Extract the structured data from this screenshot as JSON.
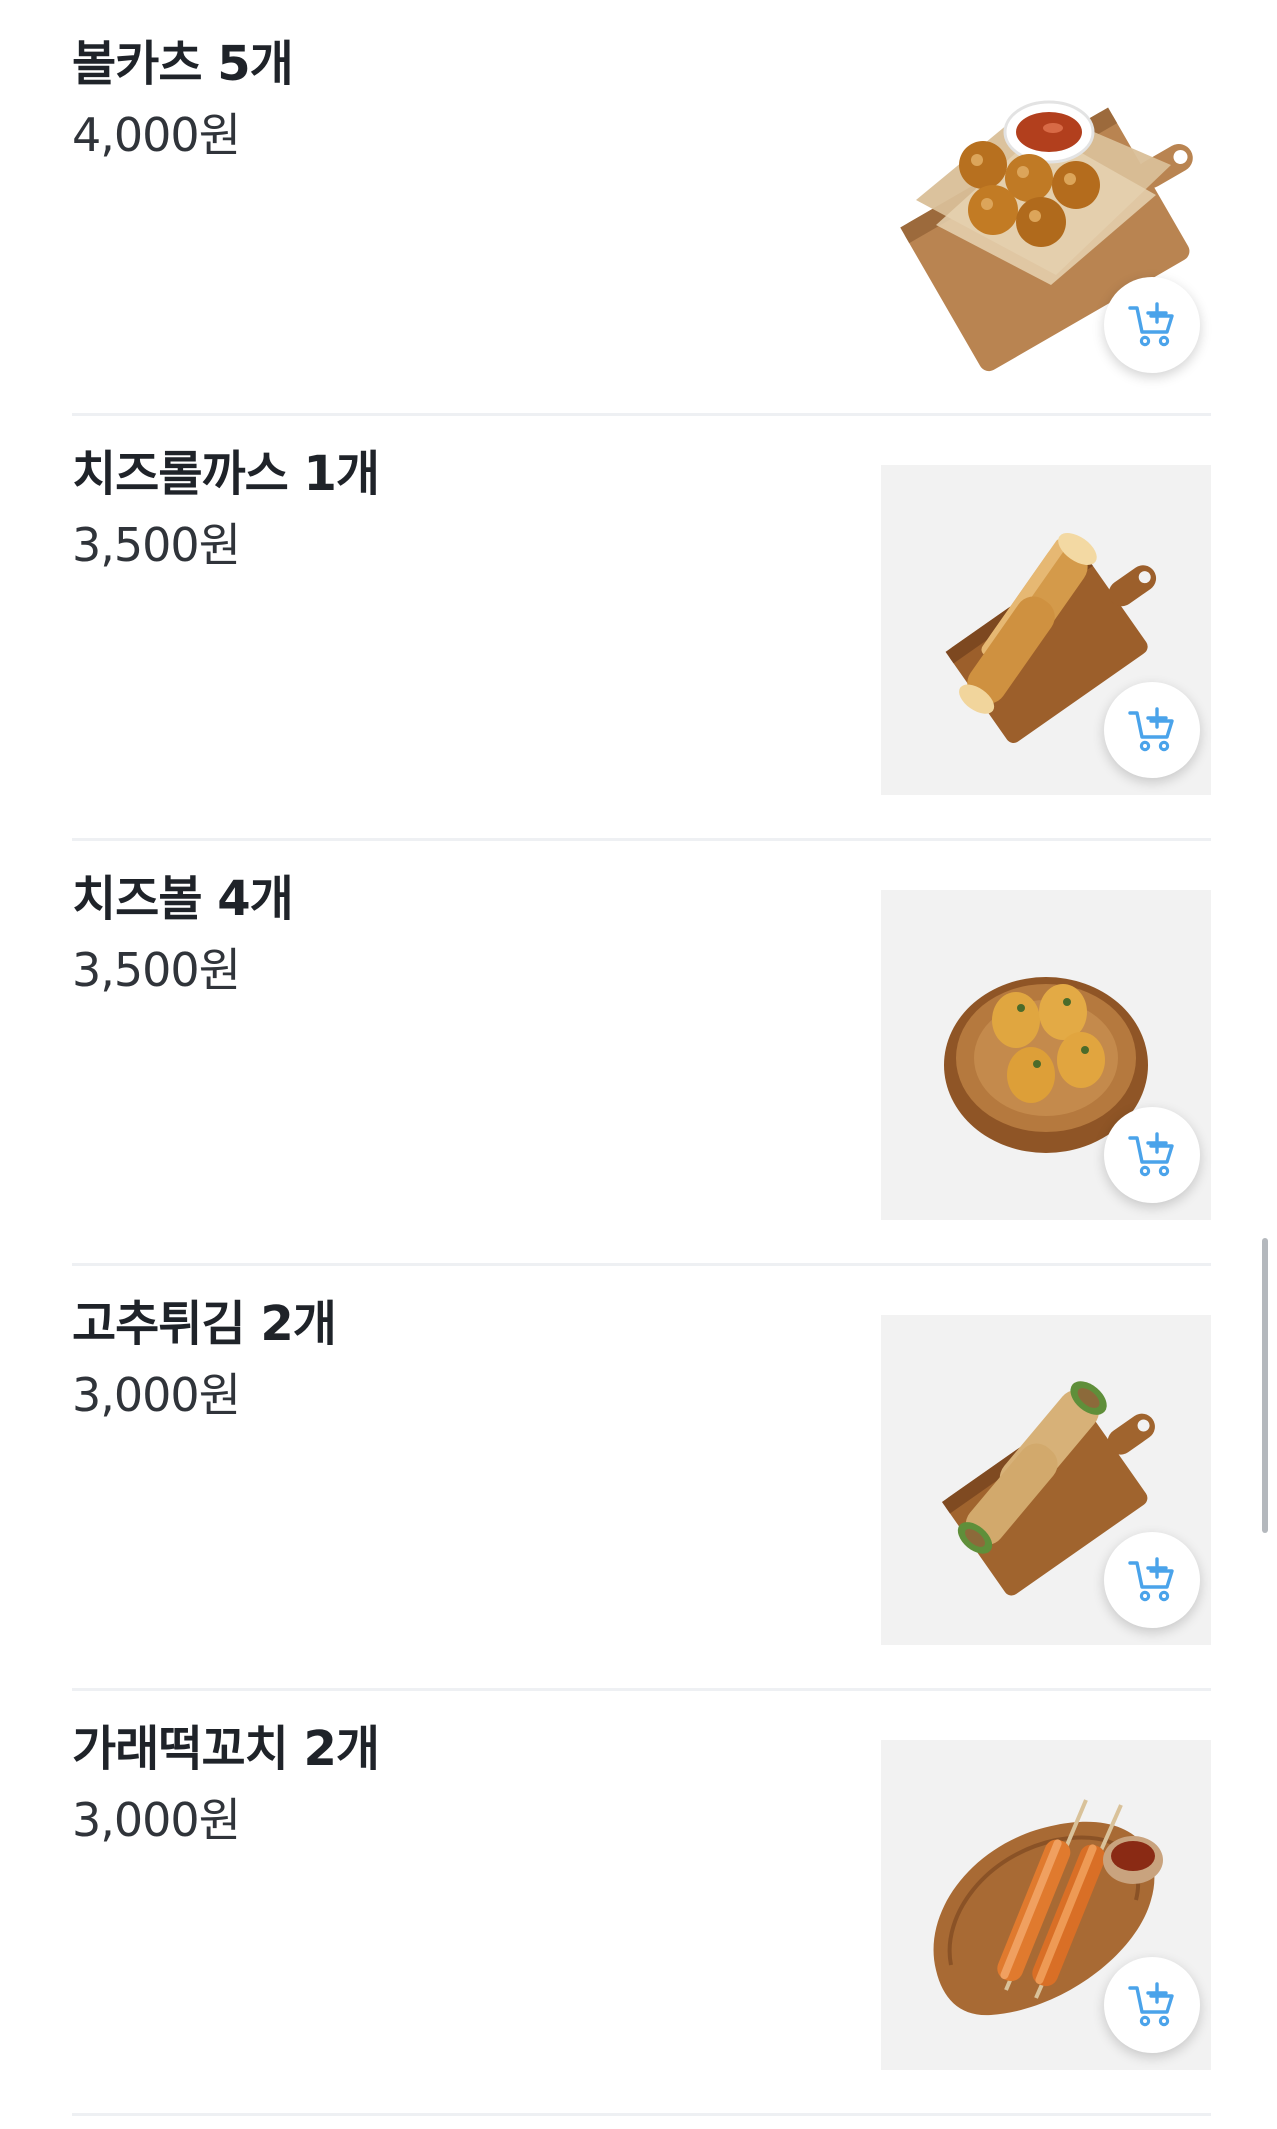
{
  "menu": {
    "items": [
      {
        "name": "볼카츠 5개",
        "price": "4,000원",
        "image_icon": "ball-katsu-photo-icon",
        "cart_icon": "add-to-cart-icon"
      },
      {
        "name": "치즈롤까스 1개",
        "price": "3,500원",
        "image_icon": "cheese-roll-katsu-photo-icon",
        "cart_icon": "add-to-cart-icon"
      },
      {
        "name": "치즈볼 4개",
        "price": "3,500원",
        "image_icon": "cheese-ball-photo-icon",
        "cart_icon": "add-to-cart-icon"
      },
      {
        "name": "고추튀김 2개",
        "price": "3,000원",
        "image_icon": "fried-pepper-photo-icon",
        "cart_icon": "add-to-cart-icon"
      },
      {
        "name": "가래떡꼬치 2개",
        "price": "3,000원",
        "image_icon": "rice-cake-skewer-photo-icon",
        "cart_icon": "add-to-cart-icon"
      }
    ]
  },
  "colors": {
    "text_primary": "#1f2329",
    "text_price": "#30343a",
    "divider": "#eef0f3",
    "cart_icon": "#4aa3ea",
    "photo_background": "#f2f2f2",
    "scrollbar": "#b4b8bd"
  }
}
